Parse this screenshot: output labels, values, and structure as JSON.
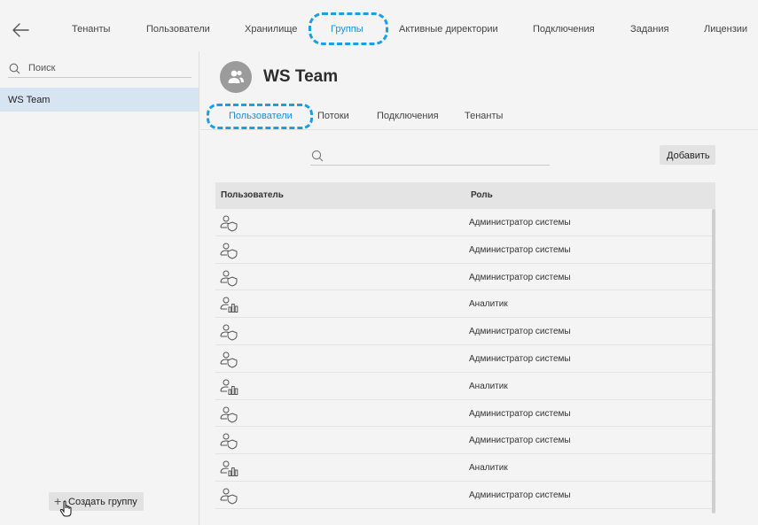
{
  "nav": {
    "tabs": [
      "Тенанты",
      "Пользователи",
      "Хранилище",
      "Группы",
      "Активные директории",
      "Подключения",
      "Задания",
      "Лицензии"
    ],
    "active_tab": "Группы"
  },
  "sidebar": {
    "search_placeholder": "Поиск",
    "items": [
      {
        "label": "WS Team",
        "selected": true
      }
    ],
    "create_label": "Создать группу"
  },
  "group": {
    "title": "WS Team",
    "tabs": [
      "Пользователи",
      "Потоки",
      "Подключения",
      "Тенанты"
    ],
    "active_tab": "Пользователи"
  },
  "users": {
    "search_value": "",
    "add_label": "Добавить",
    "columns": [
      "Пользователь",
      "Роль"
    ],
    "rows": [
      {
        "icon": "user-shield-icon",
        "role": "Администратор системы"
      },
      {
        "icon": "user-shield-icon",
        "role": "Администратор системы"
      },
      {
        "icon": "user-shield-icon",
        "role": "Администратор системы"
      },
      {
        "icon": "user-chart-icon",
        "role": "Аналитик"
      },
      {
        "icon": "user-shield-icon",
        "role": "Администратор системы"
      },
      {
        "icon": "user-shield-icon",
        "role": "Администратор системы"
      },
      {
        "icon": "user-chart-icon",
        "role": "Аналитик"
      },
      {
        "icon": "user-shield-icon",
        "role": "Администратор системы"
      },
      {
        "icon": "user-shield-icon",
        "role": "Администратор системы"
      },
      {
        "icon": "user-chart-icon",
        "role": "Аналитик"
      },
      {
        "icon": "user-shield-icon",
        "role": "Администратор системы"
      }
    ]
  },
  "colors": {
    "accent": "#1f8ed8",
    "highlight": "#1a9ee4",
    "selected_bg": "#d7e4f1"
  }
}
